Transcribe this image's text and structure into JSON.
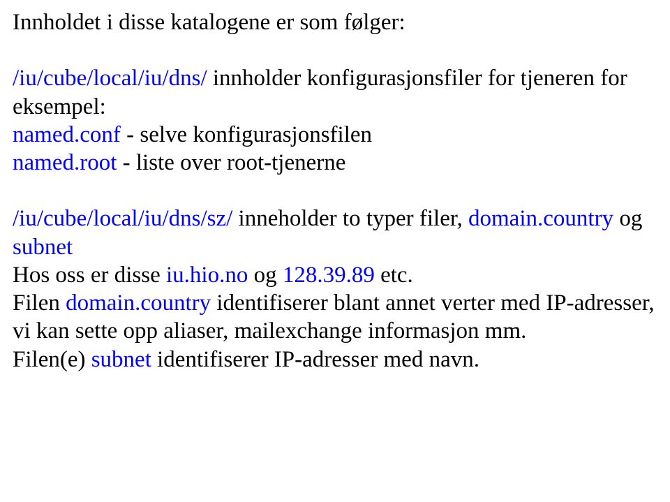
{
  "p1": {
    "heading": "Innholdet i disse katalogene er som følger:"
  },
  "p2": {
    "path": "/iu/cube/local/iu/dns/",
    "t1": " innholder konfigurasjonsfiler for tjeneren for eksempel:",
    "conf": "named.conf",
    "conf_desc": " - selve konfigurasjonsfilen",
    "root": "named.root",
    "root_desc": "   - liste over root-tjenerne"
  },
  "p3": {
    "path": "/iu/cube/local/iu/dns/sz/",
    "t1": " inneholder to typer filer, ",
    "dc": "domain.country",
    "t2": " og ",
    "sn": "subnet",
    "t3": "Hos oss er disse ",
    "iu": "iu.hio.no",
    "t4": " og ",
    "ip": "128.39.89",
    "t5": " etc.",
    "t6": "Filen ",
    "dc2": "domain.country",
    "t7": " identifiserer blant annet verter med IP-adresser, vi kan sette opp aliaser, mailexchange informasjon mm.",
    "t8": "Filen(e) ",
    "sn2": "subnet",
    "t9": " identifiserer IP-adresser med navn."
  }
}
